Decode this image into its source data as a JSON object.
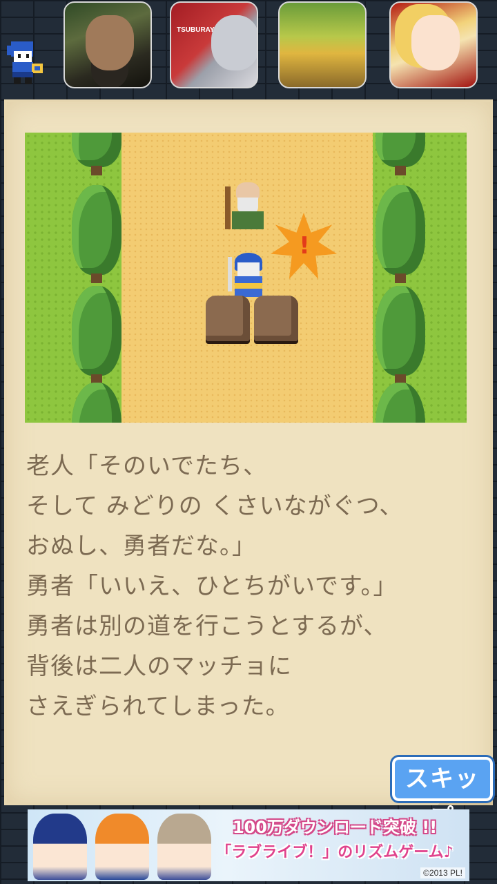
{
  "top_ads": {
    "icons": [
      {
        "name": "warlord-game-ad",
        "icon": "bearded-warrior-icon"
      },
      {
        "name": "ultraman-game-ad",
        "icon": "ultraman-icon",
        "corner_text": "TSUBURAYA"
      },
      {
        "name": "farm-game-ad",
        "icon": "farm-field-icon"
      },
      {
        "name": "anime-girl-game-ad",
        "icon": "blonde-girl-icon"
      }
    ]
  },
  "scene": {
    "alert_mark": "!"
  },
  "story": {
    "lines": [
      "老人「そのいでたち、",
      "そして みどりの くさいながぐつ、",
      "おぬし、勇者だな。」",
      "勇者「いいえ、ひとちがいです。」",
      "勇者は別の道を行こうとするが、",
      "背後は二人のマッチョに",
      "さえぎられてしまった。"
    ]
  },
  "skip_button": {
    "label": "スキップ"
  },
  "banner": {
    "headline": "100万ダウンロード突破 !!",
    "subline": "「ラブライブ！」のリズムゲーム♪",
    "copyright": "©2013 PL!"
  },
  "colors": {
    "parchment": "#efe2c0",
    "story_text": "#7c6a52",
    "skip_button": "#5aa3f2",
    "grass": "#8ec63f",
    "sand": "#f3cc72"
  }
}
